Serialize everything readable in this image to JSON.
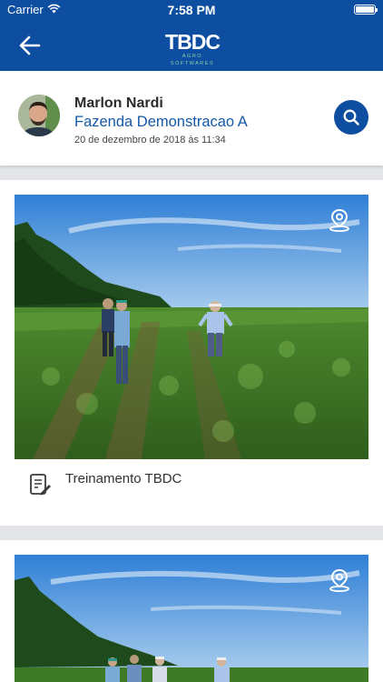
{
  "status_bar": {
    "carrier": "Carrier",
    "time": "7:58 PM"
  },
  "nav": {
    "back_icon": "arrow-left-icon",
    "logo_text": "TBDC",
    "logo_subtitle": "AGRO SOFTWARES"
  },
  "profile": {
    "name": "Marlon Nardi",
    "farm": "Fazenda Demonstracao A",
    "date": "20 de dezembro de 2018 às 11:34",
    "search_icon": "search-icon"
  },
  "posts": [
    {
      "caption": "Treinamento TBDC",
      "location_icon": "map-pin-icon",
      "note_icon": "note-edit-icon"
    },
    {
      "location_icon": "map-pin-icon"
    }
  ],
  "colors": {
    "primary": "#0d4ea0",
    "farm_link": "#1659a8",
    "background": "#e3e5e8"
  }
}
